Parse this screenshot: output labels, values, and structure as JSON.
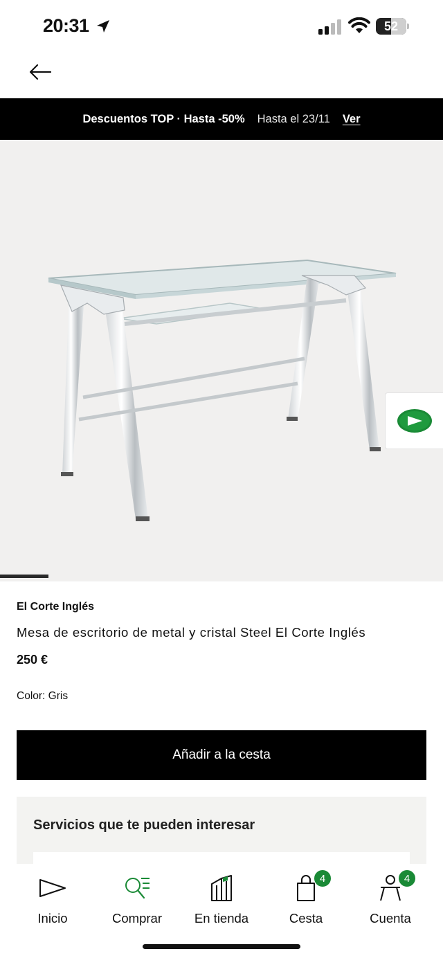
{
  "status": {
    "time": "20:31",
    "battery": "52"
  },
  "promo": {
    "main": "Descuentos TOP · Hasta -50%",
    "date": "Hasta el 23/11",
    "link": "Ver"
  },
  "product": {
    "brand": "El Corte Inglés",
    "title": "Mesa de escritorio de metal y cristal Steel El Corte Inglés",
    "price": "250 €",
    "color": "Color: Gris",
    "image_progress_fraction": 0.11
  },
  "actions": {
    "add_to_cart": "Añadir a la cesta"
  },
  "services": {
    "title": "Servicios que te pueden interesar"
  },
  "tabs": [
    {
      "label": "Inicio",
      "icon": "home-triangle-icon"
    },
    {
      "label": "Comprar",
      "icon": "search-list-icon"
    },
    {
      "label": "En tienda",
      "icon": "store-building-icon"
    },
    {
      "label": "Cesta",
      "icon": "shopping-bag-icon",
      "badge": "4"
    },
    {
      "label": "Cuenta",
      "icon": "account-icon",
      "badge": "4"
    }
  ],
  "colors": {
    "accent": "#1a8a36",
    "promo_bg": "#000000",
    "image_bg": "#f1f0ef"
  }
}
